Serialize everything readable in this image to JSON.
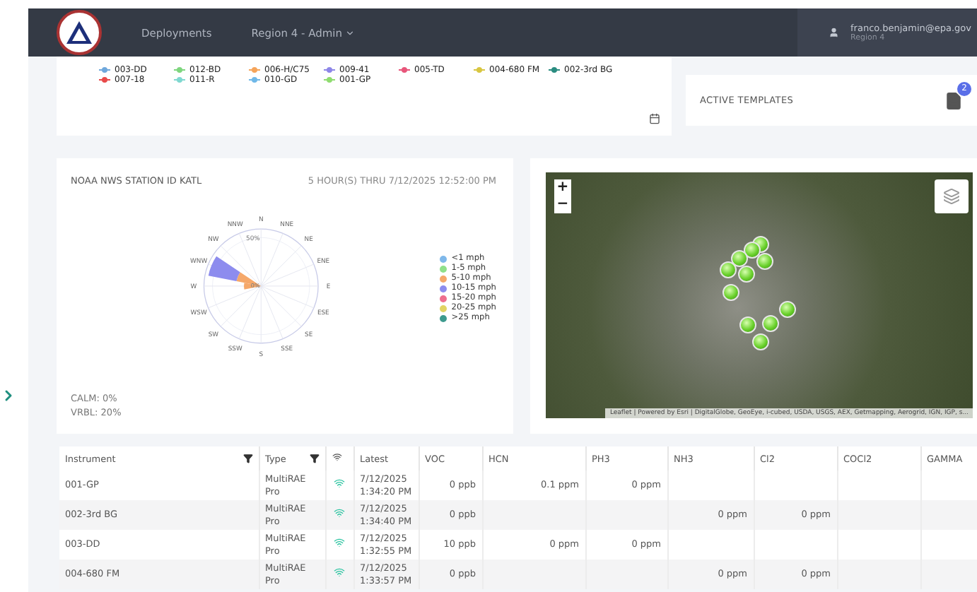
{
  "nav": {
    "links": [
      {
        "label": "Deployments",
        "dropdown": false
      },
      {
        "label": "Region 4 - Admin",
        "dropdown": true
      }
    ],
    "user": {
      "email": "franco.benjamin@epa.gov",
      "region": "Region 4"
    }
  },
  "series_legend": [
    {
      "name": "003-DD",
      "color": "#6fa8dc"
    },
    {
      "name": "012-BD",
      "color": "#7ed67e"
    },
    {
      "name": "006-H/C75",
      "color": "#f5a45a"
    },
    {
      "name": "009-41",
      "color": "#8d86e8"
    },
    {
      "name": "005-TD",
      "color": "#e8557a"
    },
    {
      "name": "004-680 FM",
      "color": "#d8c640"
    },
    {
      "name": "002-3rd BG",
      "color": "#2a8c80"
    },
    {
      "name": "007-18",
      "color": "#e84a4a"
    },
    {
      "name": "011-R",
      "color": "#7fd8d0"
    },
    {
      "name": "010-GD",
      "color": "#6fb8e8"
    },
    {
      "name": "001-GP",
      "color": "#8fdc6f"
    }
  ],
  "active_templates": {
    "title": "ACTIVE TEMPLATES",
    "count": "2"
  },
  "wind": {
    "title": "NOAA NWS STATION ID KATL",
    "period": "5 HOUR(S) THRU 7/12/2025 12:52:00 PM",
    "directions_right": [
      "N",
      "NNE",
      "NE",
      "ENE",
      "E",
      "ESE",
      "SE",
      "SSE",
      "S"
    ],
    "directions_left": [
      "NNW",
      "NW",
      "WNW",
      "W",
      "WSW",
      "SW",
      "SSW"
    ],
    "ring_label": "50%",
    "center_label": "0%",
    "speeds": [
      {
        "label": "<1 mph",
        "color": "#7fb8ea"
      },
      {
        "label": "1-5 mph",
        "color": "#8fe08a"
      },
      {
        "label": "5-10 mph",
        "color": "#f5a86a"
      },
      {
        "label": "10-15 mph",
        "color": "#8d8cee"
      },
      {
        "label": "15-20 mph",
        "color": "#ee6f8f"
      },
      {
        "label": "20-25 mph",
        "color": "#e2d463"
      },
      {
        "label": ">25 mph",
        "color": "#3d9a8e"
      }
    ],
    "calm": "CALM: 0%",
    "vrbl": "VRBL: 20%"
  },
  "map": {
    "zoom_in": "+",
    "zoom_out": "−",
    "attribution": "Leaflet | Powered by Esri | DigitalGlobe, GeoEye, i-cubed, USDA, USGS, AEX, Getmapping, Aerogrid, IGN, IGP, s..."
  },
  "table": {
    "columns": [
      {
        "label": "Instrument",
        "kind": "text",
        "filter": true
      },
      {
        "label": "Type",
        "kind": "text",
        "filter": true
      },
      {
        "kind": "signal"
      },
      {
        "label": "Latest",
        "kind": "text",
        "filter": false
      },
      {
        "label": "VOC",
        "kind": "number",
        "filter": false
      },
      {
        "label": "HCN",
        "kind": "number",
        "filter": false
      },
      {
        "label": "PH3",
        "kind": "number",
        "filter": false
      },
      {
        "label": "NH3",
        "kind": "number",
        "filter": false
      },
      {
        "label": "Cl2",
        "kind": "number",
        "filter": false
      },
      {
        "label": "COCl2",
        "kind": "number",
        "filter": false
      },
      {
        "label": "GAMMA",
        "kind": "number",
        "filter": false
      }
    ],
    "rows": [
      {
        "cells": [
          "001-GP",
          "MultiRAE Pro",
          null,
          "7/12/2025 1:34:20 PM",
          "0 ppb",
          "0.1 ppm",
          "0 ppm",
          null,
          null,
          null,
          null
        ]
      },
      {
        "cells": [
          "002-3rd BG",
          "MultiRAE Pro",
          null,
          "7/12/2025 1:34:40 PM",
          "0 ppb",
          null,
          null,
          "0 ppm",
          "0 ppm",
          null,
          null
        ]
      },
      {
        "cells": [
          "003-DD",
          "MultiRAE Pro",
          null,
          "7/12/2025 1:32:55 PM",
          "10 ppb",
          "0 ppm",
          "0 ppm",
          null,
          null,
          null,
          null
        ]
      },
      {
        "cells": [
          "004-680 FM",
          "MultiRAE Pro",
          null,
          "7/12/2025 1:33:57 PM",
          "0 ppb",
          null,
          null,
          "0 ppm",
          "0 ppm",
          null,
          null
        ]
      }
    ]
  }
}
